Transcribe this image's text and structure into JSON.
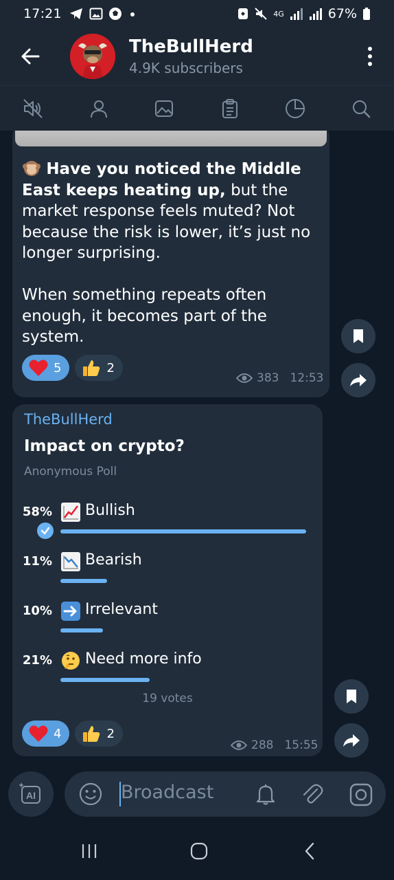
{
  "status": {
    "time": "17:21",
    "net": "4G",
    "battery": "67%"
  },
  "header": {
    "title": "TheBullHerd",
    "subtitle": "4.9K subscribers"
  },
  "toolbar": {
    "icons": [
      "mute-icon",
      "person-icon",
      "image-icon",
      "clipboard-icon",
      "pie-chart-icon",
      "search-icon"
    ]
  },
  "message1": {
    "text_bold": "Have you noticed the Middle East keeps heating up,",
    "text_rest": " but the market response feels muted? Not because the risk is lower, it’s just no longer surprising.",
    "text_para2": "When something repeats often enough, it becomes part of the system.",
    "reactions": [
      {
        "emoji": "heart",
        "count": "5"
      },
      {
        "emoji": "thumbs-up",
        "count": "2"
      }
    ],
    "views": "383",
    "time": "12:53"
  },
  "poll": {
    "author": "TheBullHerd",
    "question": "Impact on crypto?",
    "type": "Anonymous Poll",
    "options": [
      {
        "percent": "58%",
        "label": "Bullish",
        "emoji": "chart-up",
        "fraction": 0.58,
        "chosen": true
      },
      {
        "percent": "11%",
        "label": "Bearish",
        "emoji": "chart-down",
        "fraction": 0.11,
        "chosen": false
      },
      {
        "percent": "10%",
        "label": "Irrelevant",
        "emoji": "arrow-right",
        "fraction": 0.1,
        "chosen": false
      },
      {
        "percent": "21%",
        "label": "Need more info",
        "emoji": "thinking-face",
        "fraction": 0.21,
        "chosen": false
      }
    ],
    "votes": "19 votes",
    "reactions": [
      {
        "emoji": "heart",
        "count": "4"
      },
      {
        "emoji": "thumbs-up",
        "count": "2"
      }
    ],
    "views": "288",
    "time": "15:55"
  },
  "input": {
    "ai_label": "AI",
    "placeholder": "Broadcast"
  },
  "colors": {
    "accent": "#6ab2f2",
    "bubble": "#212d3b",
    "header": "#1c2733",
    "background": "#0e1621"
  }
}
